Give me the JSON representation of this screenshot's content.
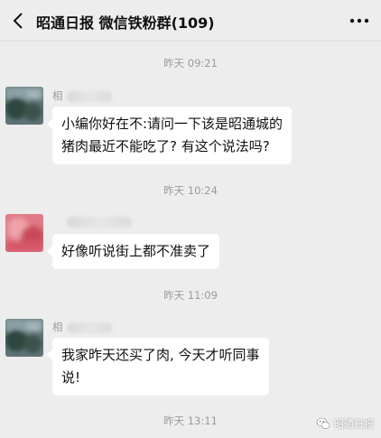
{
  "header": {
    "title": "昭通日报 微信铁粉群(109)",
    "back_icon": "chevron-left-icon",
    "more_icon": "more-dots-icon"
  },
  "messages": [
    {
      "timestamp": "昨天 09:21",
      "sender_visible": "相",
      "lines": [
        "小编你好在不:请问一下该是昭通城的",
        "猪肉最近不能吃了? 有这个说法吗?"
      ],
      "avatar_color": "#3e5a52"
    },
    {
      "timestamp": "昨天 10:24",
      "sender_visible": "",
      "lines": [
        "好像听说街上都不准卖了"
      ],
      "avatar_color": "#d9606f"
    },
    {
      "timestamp": "昨天 11:09",
      "sender_visible": "相",
      "lines": [
        "我家昨天还买了肉, 今天才听同事",
        "说!"
      ],
      "avatar_color": "#3e5a52"
    },
    {
      "timestamp": "昨天 13:11"
    }
  ],
  "watermark": {
    "text": "昭通日报",
    "icon": "wechat-icon"
  }
}
